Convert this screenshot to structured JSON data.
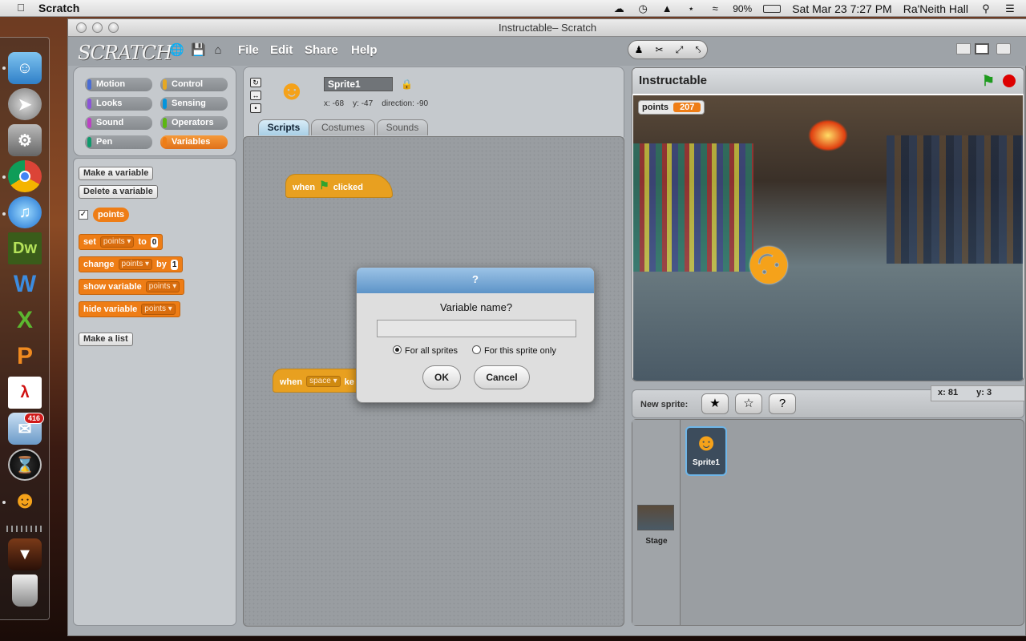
{
  "menubar": {
    "app": "Scratch",
    "battery": "90%",
    "clock": "Sat Mar 23  7:27 PM",
    "user": "Ra'Neith Hall"
  },
  "dock": {
    "badge": "416",
    "items": [
      "finder-icon",
      "launchpad-icon",
      "system-preferences-icon",
      "chrome-icon",
      "itunes-icon",
      "dreamweaver-icon",
      "word-icon",
      "excel-icon",
      "powerpoint-icon",
      "acrobat-icon",
      "mail-icon",
      "dashboard-icon",
      "scratch-icon",
      "downloads-icon",
      "trash-icon"
    ],
    "dw_label": "Dw"
  },
  "window": {
    "title": "Instructable– Scratch"
  },
  "toolbar": {
    "logo": "SCRATCH",
    "menus": [
      "File",
      "Edit",
      "Share",
      "Help"
    ]
  },
  "categories": [
    {
      "label": "Motion",
      "color": "#4a6cd4"
    },
    {
      "label": "Control",
      "color": "#e6a822"
    },
    {
      "label": "Looks",
      "color": "#8a55d7"
    },
    {
      "label": "Sensing",
      "color": "#0494dc"
    },
    {
      "label": "Sound",
      "color": "#bb42c3"
    },
    {
      "label": "Operators",
      "color": "#5cb712"
    },
    {
      "label": "Pen",
      "color": "#0e9a6c"
    },
    {
      "label": "Variables",
      "color": "#ee7d16"
    }
  ],
  "palette": {
    "make_variable": "Make a variable",
    "delete_variable": "Delete a variable",
    "variable_name": "points",
    "set": {
      "label": "set",
      "var": "points",
      "to": "to",
      "value": "0"
    },
    "change": {
      "label": "change",
      "var": "points",
      "by": "by",
      "value": "1"
    },
    "show": {
      "label": "show variable",
      "var": "points"
    },
    "hide": {
      "label": "hide variable",
      "var": "points"
    },
    "make_list": "Make a list"
  },
  "sprite": {
    "name": "Sprite1",
    "x_label": "x:",
    "x": "-68",
    "y_label": "y:",
    "y": "-47",
    "direction_label": "direction:",
    "direction": "-90"
  },
  "tabs": [
    "Scripts",
    "Costumes",
    "Sounds"
  ],
  "scripts": {
    "hat1": {
      "when": "when",
      "clicked": "clicked"
    },
    "hat2": {
      "when": "when",
      "key": "space",
      "rest": "ke"
    }
  },
  "stage": {
    "title": "Instructable",
    "var_label": "points",
    "var_value": "207",
    "mouse_x_label": "x:",
    "mouse_x": "81",
    "mouse_y_label": "y:",
    "mouse_y": "3"
  },
  "new_sprite": {
    "label": "New sprite:"
  },
  "sprites": [
    {
      "name": "Sprite1"
    }
  ],
  "stage_thumb": {
    "label": "Stage"
  },
  "dialog": {
    "title": "?",
    "prompt": "Variable name?",
    "input_value": "",
    "option_all": "For all sprites",
    "option_this": "For this sprite only",
    "selected": "For all sprites",
    "ok": "OK",
    "cancel": "Cancel"
  }
}
